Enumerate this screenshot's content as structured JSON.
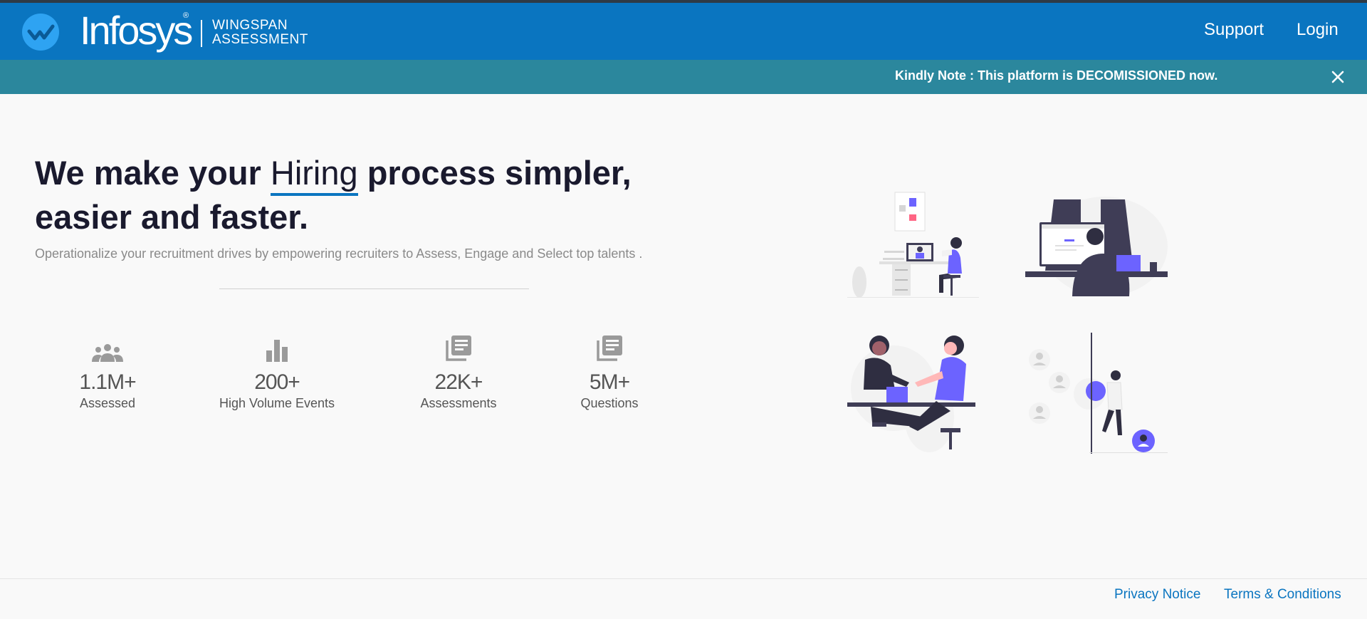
{
  "header": {
    "brand": "Infosys",
    "brand_mark": "®",
    "product_line1": "WINGSPAN",
    "product_line2": "ASSESSMENT",
    "nav": {
      "support": "Support",
      "login": "Login"
    },
    "logo_icon": "wingspan-logo-icon",
    "color": "#0a75c0"
  },
  "notice": {
    "text": "Kindly Note : This platform is DECOMISSIONED now.",
    "close_icon": "close-icon",
    "color": "#2b879d"
  },
  "hero": {
    "title_part1": "We make your ",
    "title_highlight": "Hiring",
    "title_part2": " process simpler, easier and faster.",
    "description": "Operationalize your recruitment drives by empowering recruiters to Assess, Engage and Select top talents ."
  },
  "stats": [
    {
      "icon": "people-icon",
      "value": "1.1M+",
      "label": "Assessed"
    },
    {
      "icon": "bar-chart-icon",
      "value": "200+",
      "label": "High Volume Events"
    },
    {
      "icon": "library-books-icon",
      "value": "22K+",
      "label": "Assessments"
    },
    {
      "icon": "library-books-icon",
      "value": "5M+",
      "label": "Questions"
    }
  ],
  "footer": {
    "privacy": "Privacy Notice",
    "terms": "Terms & Conditions"
  }
}
